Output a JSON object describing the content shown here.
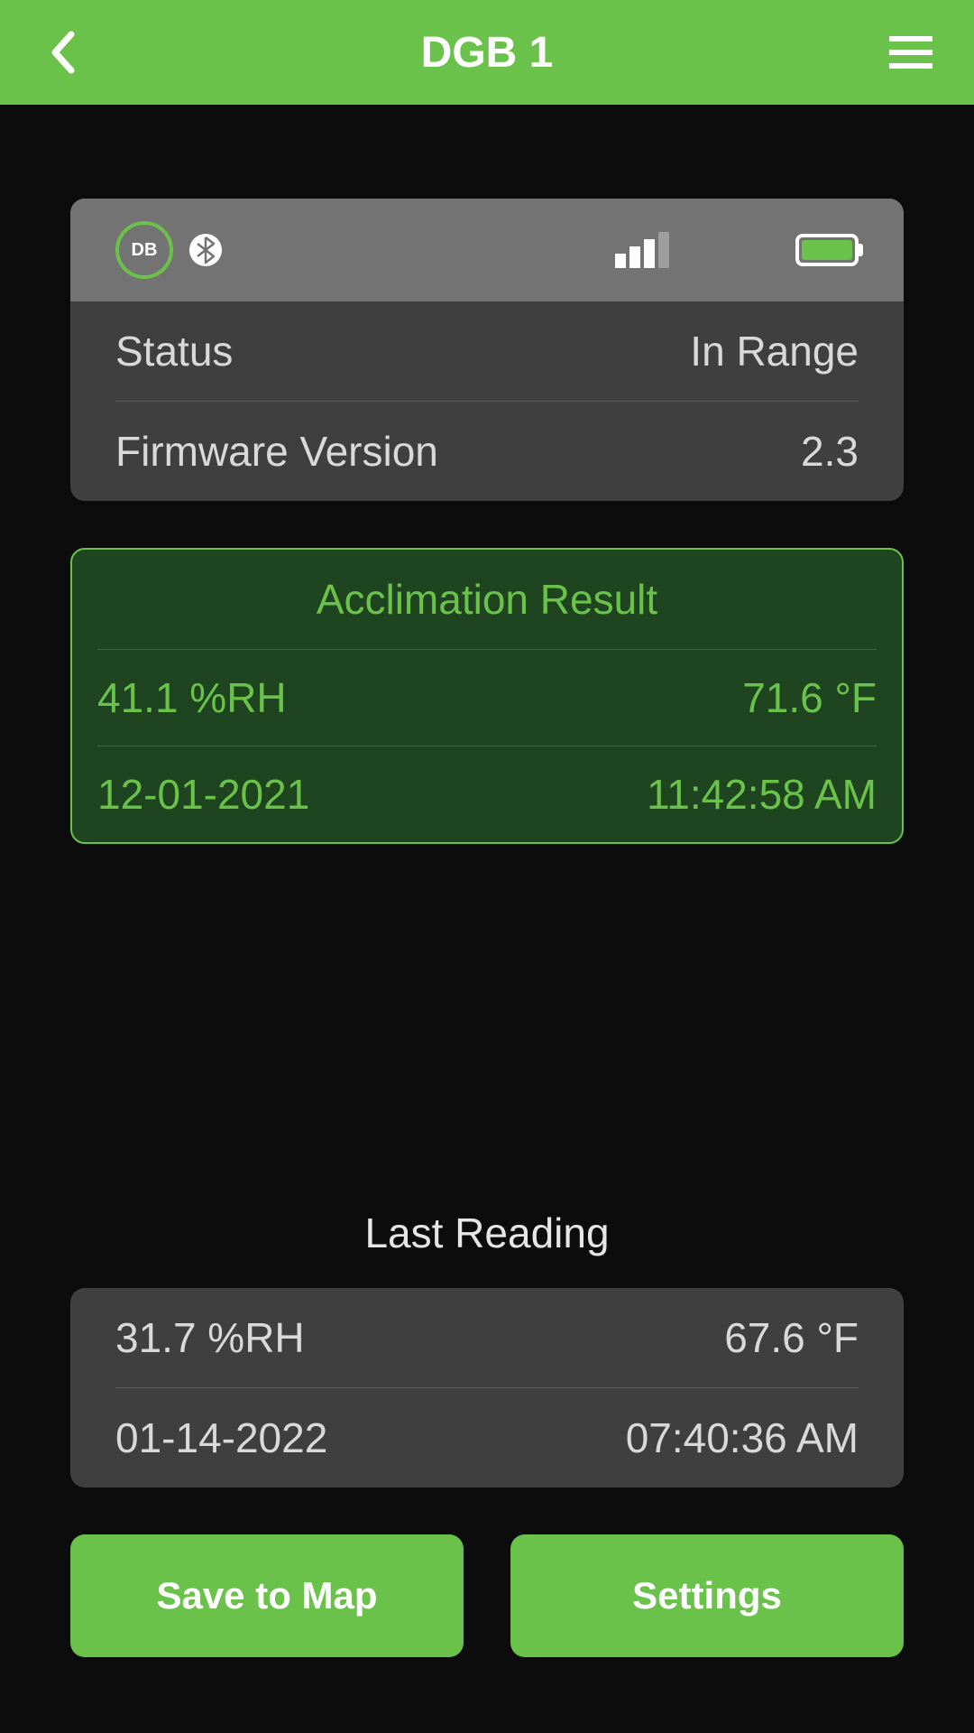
{
  "header": {
    "title": "DGB 1"
  },
  "device": {
    "badge_label": "DB",
    "status_label": "Status",
    "status_value": "In Range",
    "firmware_label": "Firmware Version",
    "firmware_value": "2.3"
  },
  "acclimation": {
    "title": "Acclimation Result",
    "humidity": "41.1 %RH",
    "temperature": "71.6 °F",
    "date": "12-01-2021",
    "time": "11:42:58 AM"
  },
  "last_reading": {
    "title": "Last Reading",
    "humidity": "31.7 %RH",
    "temperature": "67.6 °F",
    "date": "01-14-2022",
    "time": "07:40:36 AM"
  },
  "buttons": {
    "save": "Save to Map",
    "settings": "Settings"
  }
}
